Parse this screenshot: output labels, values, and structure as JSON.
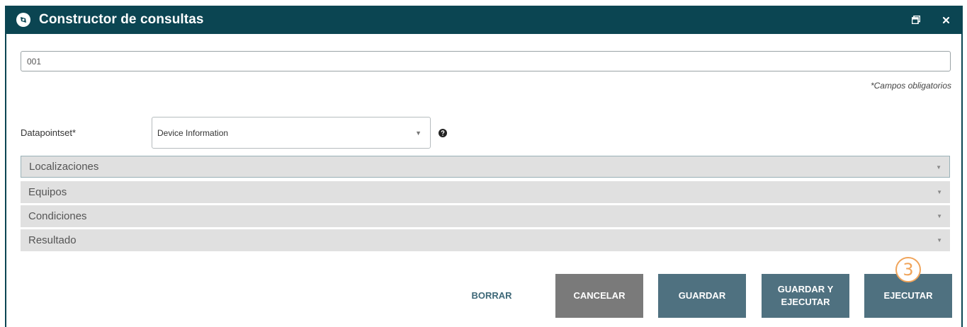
{
  "window": {
    "title": "Constructor de consultas",
    "icon": "compass-icon",
    "restore_icon": "restore-window-icon",
    "close_icon": "close-icon"
  },
  "form": {
    "name_value": "001",
    "required_note": "*Campos obligatorios",
    "datapointset_label": "Datapointset*",
    "datapointset_value": "Device Information"
  },
  "sections": [
    {
      "label": "Localizaciones"
    },
    {
      "label": "Equipos"
    },
    {
      "label": "Condiciones"
    },
    {
      "label": "Resultado"
    }
  ],
  "buttons": {
    "clear": "BORRAR",
    "cancel": "CANCELAR",
    "save": "GUARDAR",
    "save_run_line1": "GUARDAR Y",
    "save_run_line2": "EJECUTAR",
    "run": "EJECUTAR"
  },
  "annotation": {
    "step": "3"
  },
  "colors": {
    "titlebar": "#0b4552",
    "button_primary": "#4f7180",
    "button_cancel": "#7a7a7a",
    "annotation": "#f0a45a"
  }
}
